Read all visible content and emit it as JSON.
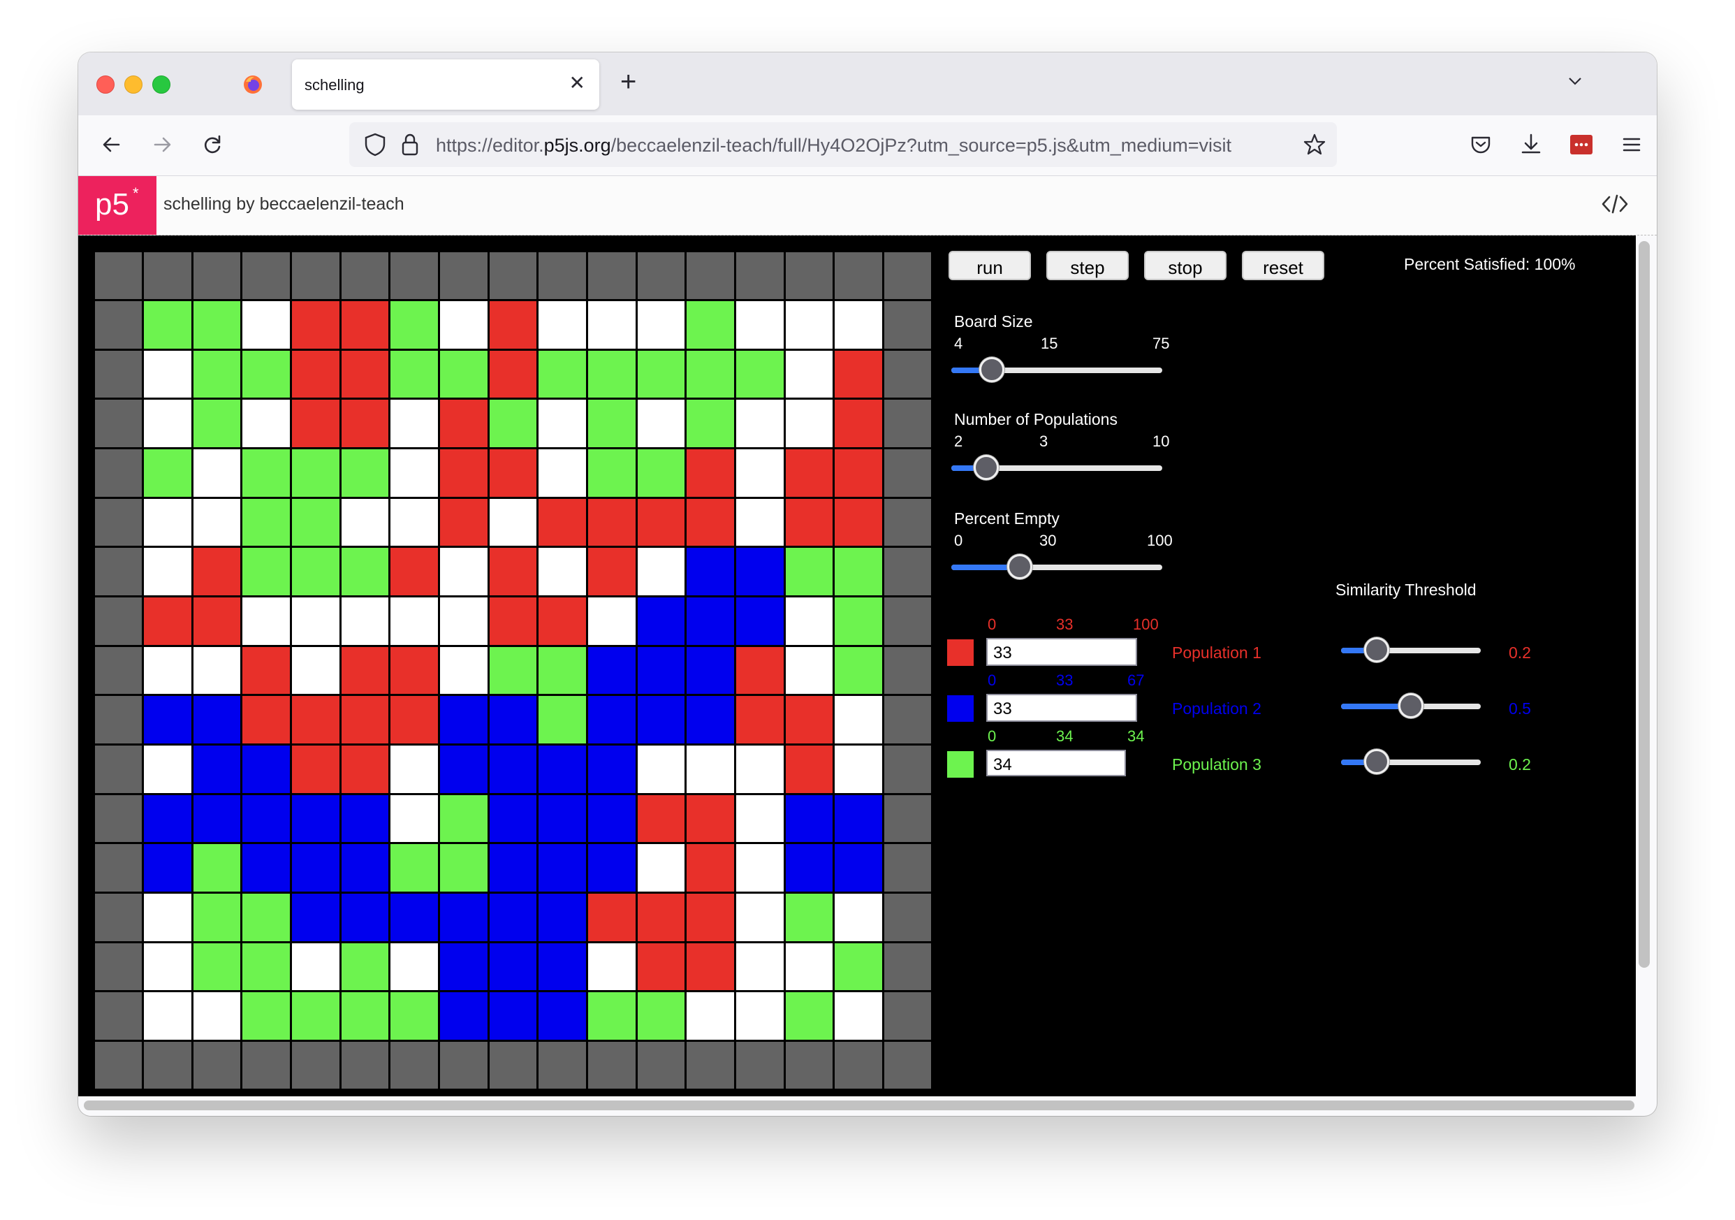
{
  "browser": {
    "tab_title": "schelling",
    "url_prefix": "https://editor.",
    "url_host": "p5js.org",
    "url_rest": "/beccaelenzil-teach/full/Hy4O2OjPz?utm_source=p5.js&utm_medium=visit"
  },
  "header": {
    "logo": "p5",
    "logo_mark": "*",
    "sketch_name": "schelling",
    "by": "by",
    "author": "beccaelenzil-teach",
    "code_icon": "code-icon"
  },
  "controls": {
    "run": "run",
    "step": "step",
    "stop": "stop",
    "reset": "reset",
    "percent_satisfied": "Percent Satisfied: 100%"
  },
  "sliders": {
    "board_size": {
      "label": "Board Size",
      "min": "4",
      "value": "15",
      "max": "75",
      "fraction": 0.15
    },
    "num_pops": {
      "label": "Number of Populations",
      "min": "2",
      "value": "3",
      "max": "10",
      "fraction": 0.12
    },
    "percent_empty": {
      "label": "Percent Empty",
      "min": "0",
      "value": "30",
      "max": "100",
      "fraction": 0.3
    }
  },
  "similarity_title": "Similarity Threshold",
  "populations": [
    {
      "label": "Population 1",
      "min": "0",
      "mid": "33",
      "max": "100",
      "input": "33",
      "threshold": "0.2",
      "threshold_fraction": 0.2,
      "color": "#e8302a"
    },
    {
      "label": "Population 2",
      "min": "0",
      "mid": "33",
      "max": "67",
      "input": "33",
      "threshold": "0.5",
      "threshold_fraction": 0.5,
      "color": "#0000ee"
    },
    {
      "label": "Population 3",
      "min": "0",
      "mid": "34",
      "max": "34",
      "input": "34",
      "threshold": "0.2",
      "threshold_fraction": 0.2,
      "color": "#6df34f"
    }
  ],
  "colors": {
    "R": "#e8302a",
    "G": "#6df34f",
    "B": "#0000ee",
    "W": "#ffffff",
    "X": "#646464"
  },
  "grid": [
    "XXXXXXXXXXXXXXXXX",
    "XGGWRRGWRWWWGWWWX",
    "XWGGRRGGRGGGGGWRX",
    "XWGWRRWRGWGWGWWRX",
    "XGWGGGWRRWGGRWRRX",
    "XWWGGWWRWRRRRWRRX",
    "XWRGGGRWRWRWBBGGX",
    "XRRWWWWWRRWBBBWGX",
    "XWWRWRRWGGBBBRWGX",
    "XBBRRRRBBGBBBRRWX",
    "XWBBRRWBBBBWWWRWX",
    "XBBBBBWGBBBRRWBBX",
    "XBGBBBGGBBBWRWBBX",
    "XWGGBBBBBBRRRWGWX",
    "XWGGWGWBBBWRRWWGX",
    "XWWGGGGBBBGGWWGWX",
    "XXXXXXXXXXXXXXXXX"
  ]
}
